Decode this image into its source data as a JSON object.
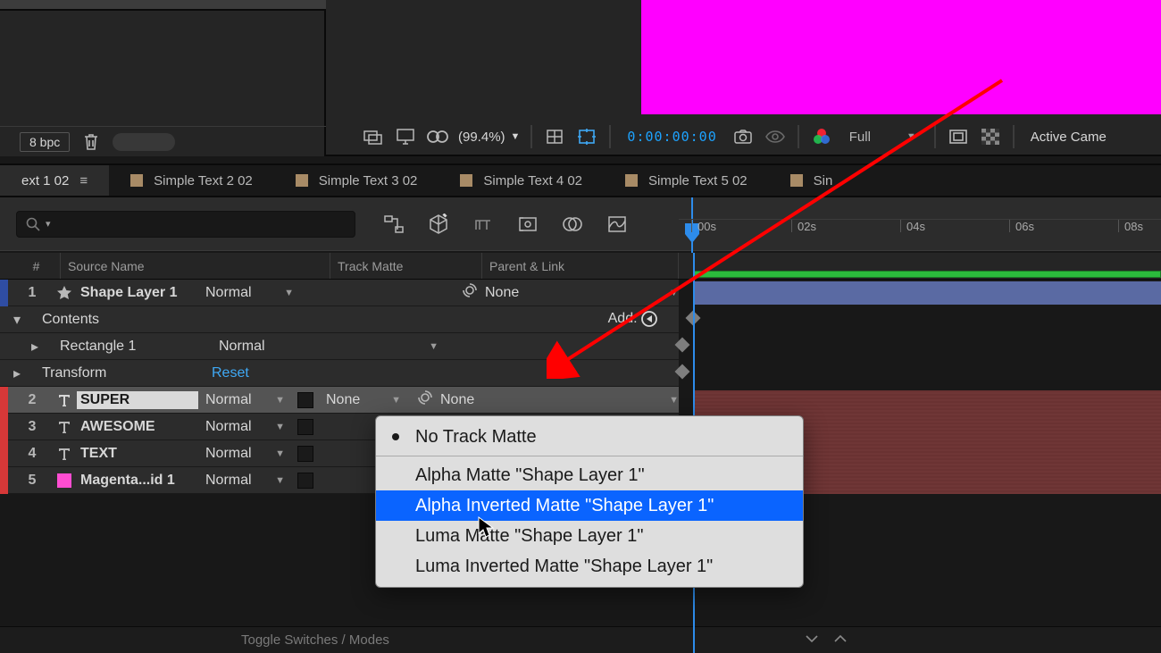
{
  "colors": {
    "magenta": "#ff00ff",
    "accent": "#2d8ceb",
    "red_edge": "#d63838",
    "blue_edge": "#2f4da3",
    "pink_edge": "#ff4dd2"
  },
  "project": {
    "bpc": "8 bpc"
  },
  "preview": {
    "zoom": "(99.4%)",
    "timecode": "0:00:00:00",
    "resolution": "Full",
    "camera": "Active Came"
  },
  "tabs": {
    "items": [
      {
        "label": "ext 1 02",
        "active": true
      },
      {
        "label": "Simple Text 2 02"
      },
      {
        "label": "Simple Text 3 02"
      },
      {
        "label": "Simple Text 4 02"
      },
      {
        "label": "Simple Text 5 02"
      },
      {
        "label": "Sin"
      }
    ]
  },
  "ruler": {
    "ticks": [
      "00s",
      "02s",
      "04s",
      "06s",
      "08s"
    ]
  },
  "columns": {
    "num": "#",
    "name": "Source Name",
    "track": "Track Matte",
    "parent": "Parent & Link"
  },
  "layers": {
    "r1": {
      "num": "1",
      "name": "Shape Layer 1",
      "mode": "Normal",
      "parent": "None"
    },
    "contents": {
      "label": "Contents",
      "add": "Add:"
    },
    "rect": {
      "label": "Rectangle 1",
      "mode": "Normal"
    },
    "transform": {
      "label": "Transform",
      "reset": "Reset"
    },
    "r2": {
      "num": "2",
      "name": "SUPER",
      "mode": "Normal",
      "trk": "None",
      "parent": "None"
    },
    "r3": {
      "num": "3",
      "name": "AWESOME",
      "mode": "Normal"
    },
    "r4": {
      "num": "4",
      "name": "TEXT",
      "mode": "Normal"
    },
    "r5": {
      "num": "5",
      "name": "Magenta...id 1",
      "mode": "Normal"
    }
  },
  "menu": {
    "items": [
      "No Track Matte",
      "Alpha Matte \"Shape Layer 1\"",
      "Alpha Inverted Matte \"Shape Layer 1\"",
      "Luma Matte \"Shape Layer 1\"",
      "Luma Inverted Matte \"Shape Layer 1\""
    ],
    "selected_index": 2,
    "checked_index": 0
  },
  "bottom": {
    "toggle": "Toggle Switches / Modes"
  }
}
